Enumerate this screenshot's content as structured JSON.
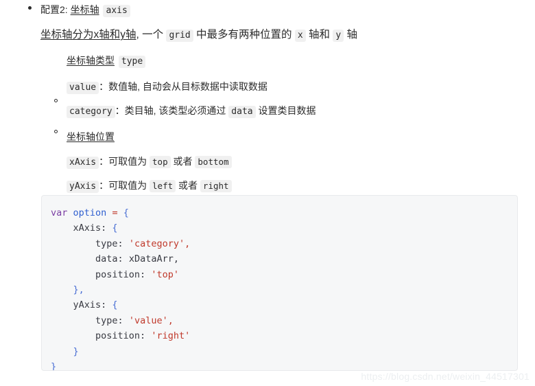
{
  "document": {
    "bullet_l1": "•",
    "bullet_l2": "◦"
  },
  "section": {
    "heading_prefix": "配置2: ",
    "heading_term": "坐标轴",
    "heading_code": "axis",
    "intro_part1": "坐标轴分为x轴和y轴",
    "intro_comma": ", 一个 ",
    "intro_code_grid": "grid",
    "intro_part2": " 中最多有两种位置的 ",
    "intro_code_x": "x",
    "intro_mid": " 轴和 ",
    "intro_code_y": "y",
    "intro_tail": " 轴"
  },
  "type_group": {
    "title": "坐标轴类型",
    "title_code": "type",
    "items": [
      {
        "code": "value",
        "colon": "：",
        "desc": "数值轴, 自动会从目标数据中读取数据"
      },
      {
        "code": "category",
        "colon": "：",
        "desc_pre": "类目轴, 该类型必须通过 ",
        "desc_code": "data",
        "desc_post": " 设置类目数据"
      }
    ]
  },
  "position_group": {
    "title": "坐标轴位置",
    "items": [
      {
        "code": "xAxis",
        "colon": "：",
        "label": "可取值为 ",
        "value_a": "top",
        "or": " 或者 ",
        "value_b": "bottom"
      },
      {
        "code": "yAxis",
        "colon": "：",
        "label": "可取值为 ",
        "value_a": "left",
        "or": " 或者 ",
        "value_b": "right"
      }
    ]
  },
  "code_block": {
    "language": "javascript",
    "lines": [
      "var option = {",
      "    xAxis: {",
      "        type: 'category',",
      "        data: xDataArr,",
      "        position: 'top'",
      "    },",
      "    yAxis: {",
      "        type: 'value',",
      "        position: 'right'",
      "    }",
      "}"
    ],
    "tokens": {
      "kw_var": "var",
      "var_option": "option",
      "op_eq": "=",
      "brace_open": "{",
      "brace_close": "}",
      "key_xaxis": "xAxis: ",
      "key_yaxis": "yAxis: ",
      "key_type": "type: ",
      "key_data": "data: ",
      "key_position": "position: ",
      "str_category": "'category',",
      "str_value": "'value',",
      "str_top": "'top'",
      "str_right": "'right'",
      "val_xdataarr": "xDataArr,",
      "close_comma": "},",
      "close_plain": "}"
    }
  },
  "watermark": {
    "text": "https://blog.csdn.net/weixin_44517301"
  },
  "colors": {
    "text": "#2b2b2b",
    "inline_code_bg": "#f0f0f0",
    "code_block_bg": "#f6f7f8",
    "code_block_border": "#e8eaec",
    "keyword": "#7a3ea3",
    "variable": "#2f5fd0",
    "string": "#c0392b",
    "brace": "#4a6fd4",
    "watermark": "#eceff1"
  }
}
